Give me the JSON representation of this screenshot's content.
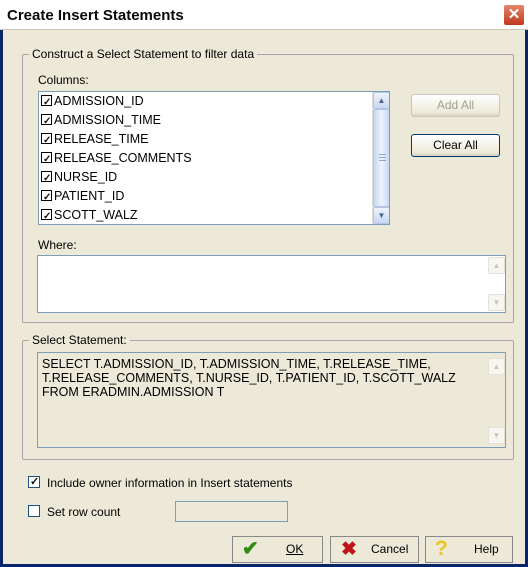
{
  "window": {
    "title": "Create Insert Statements",
    "close_glyph": "✕"
  },
  "construct": {
    "group_label": "Construct a Select Statement to filter data",
    "columns_label": "Columns:",
    "columns": [
      {
        "label": "ADMISSION_ID",
        "checked": true
      },
      {
        "label": "ADMISSION_TIME",
        "checked": true
      },
      {
        "label": "RELEASE_TIME",
        "checked": true
      },
      {
        "label": "RELEASE_COMMENTS",
        "checked": true
      },
      {
        "label": "NURSE_ID",
        "checked": true
      },
      {
        "label": "PATIENT_ID",
        "checked": true
      },
      {
        "label": "SCOTT_WALZ",
        "checked": true
      }
    ],
    "add_all_label": "Add All",
    "clear_all_label": "Clear All",
    "where_label": "Where:",
    "where_value": ""
  },
  "select": {
    "group_label": "Select Statement:",
    "statement": "SELECT T.ADMISSION_ID, T.ADMISSION_TIME, T.RELEASE_TIME, T.RELEASE_COMMENTS, T.NURSE_ID, T.PATIENT_ID, T.SCOTT_WALZ FROM ERADMIN.ADMISSION T"
  },
  "options": {
    "include_owner_label": "Include owner information in Insert statements",
    "include_owner_checked": true,
    "set_row_count_label": "Set row count",
    "set_row_count_checked": false,
    "row_count_value": ""
  },
  "buttons": {
    "ok_label": "OK",
    "cancel_label": "Cancel",
    "help_label": "Help"
  },
  "colors": {
    "ok_check": "#2e8b0f",
    "cancel_x": "#c0141a",
    "help_q": "#f0c419"
  },
  "icons": {
    "ok": "check-icon",
    "cancel": "x-icon",
    "help": "question-icon"
  }
}
